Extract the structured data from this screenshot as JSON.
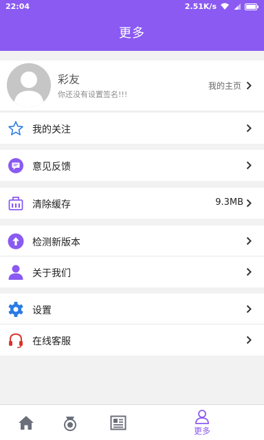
{
  "status_bar": {
    "time": "22:04",
    "network_speed": "2.51K/s"
  },
  "header": {
    "title": "更多"
  },
  "profile": {
    "name": "彩友",
    "signature": "你还没有设置签名!!!",
    "home_link": "我的主页"
  },
  "menu": {
    "follow": {
      "label": "我的关注",
      "icon": "star-icon"
    },
    "feedback": {
      "label": "意见反馈",
      "icon": "message-icon"
    },
    "cache": {
      "label": "清除缓存",
      "value": "9.3MB",
      "icon": "cache-icon"
    },
    "update": {
      "label": "检测新版本",
      "icon": "upload-icon"
    },
    "about": {
      "label": "关于我们",
      "icon": "person-icon"
    },
    "settings": {
      "label": "设置",
      "icon": "gear-icon"
    },
    "service": {
      "label": "在线客服",
      "icon": "headset-icon"
    }
  },
  "tabbar": {
    "tabs": [
      {
        "name": "home",
        "icon": "home-icon",
        "label": ""
      },
      {
        "name": "draw",
        "icon": "lottery-icon",
        "label": ""
      },
      {
        "name": "news",
        "icon": "news-icon",
        "label": ""
      },
      {
        "name": "more",
        "icon": "user-icon",
        "label": "更多",
        "active": true
      }
    ]
  },
  "colors": {
    "accent": "#8a5af2",
    "icon_blue": "#2a7be4",
    "icon_red": "#d9342b"
  }
}
